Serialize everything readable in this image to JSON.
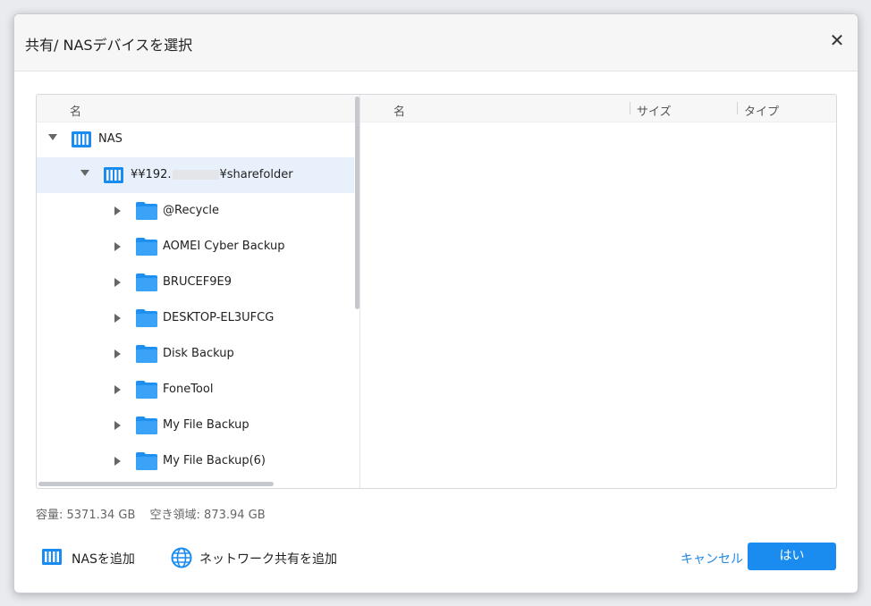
{
  "dialog": {
    "title": "共有/ NASデバイスを選択",
    "close_icon": "close-icon"
  },
  "tree": {
    "header": "名",
    "root": {
      "label": "NAS",
      "icon": "nas-icon",
      "expanded": true
    },
    "share": {
      "label_prefix": "¥¥192.",
      "label_suffix": "¥sharefolder",
      "icon": "nas-icon",
      "expanded": true,
      "selected": true
    },
    "folders": [
      {
        "label": "@Recycle"
      },
      {
        "label": "AOMEI Cyber Backup"
      },
      {
        "label": "BRUCEF9E9"
      },
      {
        "label": "DESKTOP-EL3UFCG"
      },
      {
        "label": "Disk Backup"
      },
      {
        "label": "FoneTool"
      },
      {
        "label": "My File Backup"
      },
      {
        "label": "My File Backup(6)"
      }
    ]
  },
  "list": {
    "col_name": "名",
    "col_size": "サイズ",
    "col_type": "タイプ"
  },
  "capacity": {
    "total": "容量: 5371.34 GB",
    "free": "空き領域: 873.94 GB"
  },
  "footer": {
    "add_nas": "NASを追加",
    "add_network_share": "ネットワーク共有を追加",
    "cancel": "キャンセル",
    "ok": "はい"
  },
  "colors": {
    "accent": "#1a8cf0",
    "selected_row": "#e8f1fb",
    "folder": "#1e90f0"
  }
}
